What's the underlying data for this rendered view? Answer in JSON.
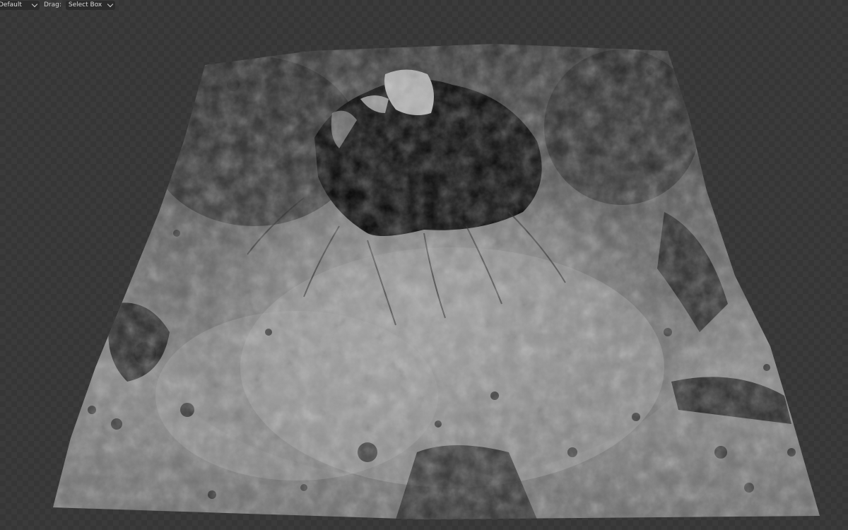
{
  "header": {
    "mode_select": {
      "value": "Default"
    },
    "drag_label": "Drag:",
    "drag_select": {
      "value": "Select Box"
    }
  },
  "icons": {
    "mode_dropdown": "chevron-down-icon",
    "drag_dropdown": "chevron-down-icon"
  },
  "viewport": {
    "object": "terrain-mesh",
    "colors": {
      "background": "#3b3b3b",
      "checker": "#363636",
      "terrain_light": "#9a9a9a",
      "terrain_dark": "#141414",
      "crater_shadow": "#050505"
    }
  }
}
